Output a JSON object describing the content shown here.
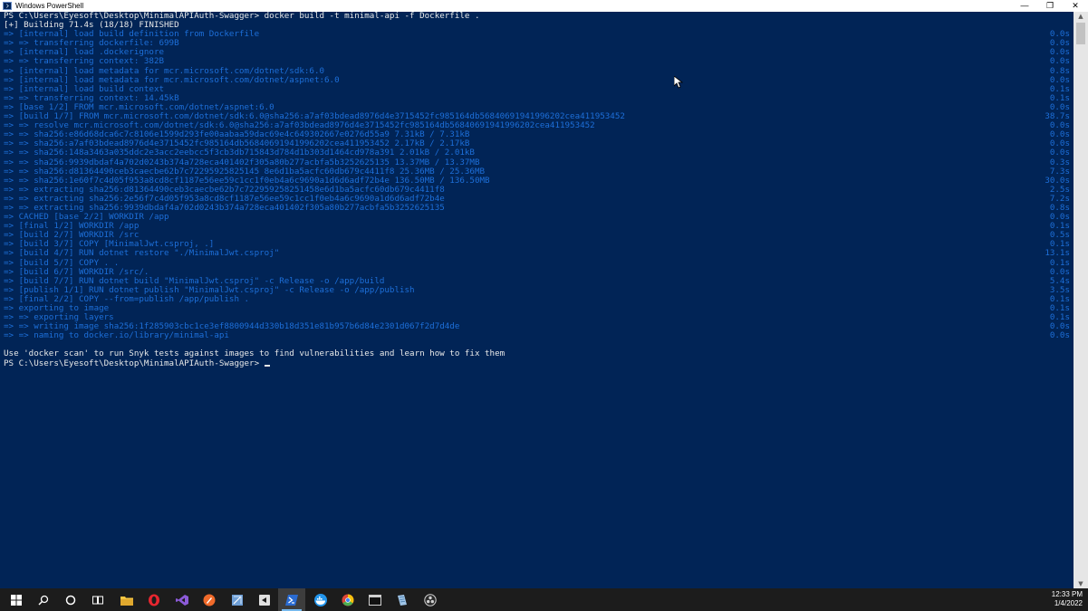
{
  "window": {
    "title": "Windows PowerShell",
    "controls": {
      "minimize": "—",
      "maximize": "❐",
      "close": "✕"
    }
  },
  "console": {
    "lines": [
      {
        "style": "white",
        "text": "PS C:\\Users\\Eyesoft\\Desktop\\MinimalAPIAuth-Swagger> docker build -t minimal-api -f Dockerfile .",
        "time": ""
      },
      {
        "style": "white",
        "text": "[+] Building 71.4s (18/18) FINISHED",
        "time": ""
      },
      {
        "style": "blue",
        "text": "=> [internal] load build definition from Dockerfile",
        "time": "0.0s"
      },
      {
        "style": "blue",
        "text": "=> => transferring dockerfile: 699B",
        "time": "0.0s"
      },
      {
        "style": "blue",
        "text": "=> [internal] load .dockerignore",
        "time": "0.0s"
      },
      {
        "style": "blue",
        "text": "=> => transferring context: 382B",
        "time": "0.0s"
      },
      {
        "style": "blue",
        "text": "=> [internal] load metadata for mcr.microsoft.com/dotnet/sdk:6.0",
        "time": "0.8s"
      },
      {
        "style": "blue",
        "text": "=> [internal] load metadata for mcr.microsoft.com/dotnet/aspnet:6.0",
        "time": "0.0s"
      },
      {
        "style": "blue",
        "text": "=> [internal] load build context",
        "time": "0.1s"
      },
      {
        "style": "blue",
        "text": "=> => transferring context: 14.45kB",
        "time": "0.1s"
      },
      {
        "style": "blue",
        "text": "=> [base 1/2] FROM mcr.microsoft.com/dotnet/aspnet:6.0",
        "time": "0.0s"
      },
      {
        "style": "blue",
        "text": "=> [build 1/7] FROM mcr.microsoft.com/dotnet/sdk:6.0@sha256:a7af03bdead8976d4e3715452fc985164db56840691941996202cea411953452",
        "time": "38.7s"
      },
      {
        "style": "blue",
        "text": "=> => resolve mcr.microsoft.com/dotnet/sdk:6.0@sha256:a7af03bdead8976d4e3715452fc985164db56840691941996202cea411953452",
        "time": "0.0s"
      },
      {
        "style": "blue",
        "text": "=> => sha256:e86d68dca6c7c8106e1599d293fe00aabaa59dac69e4c649302667e0276d55a9 7.31kB / 7.31kB",
        "time": "0.0s"
      },
      {
        "style": "blue",
        "text": "=> => sha256:a7af03bdead8976d4e3715452fc985164db56840691941996202cea411953452 2.17kB / 2.17kB",
        "time": "0.0s"
      },
      {
        "style": "blue",
        "text": "=> => sha256:148a3463a035ddc2e3acc2eebcc5f3cb3db715843d784d1b303d1464cd978a391 2.01kB / 2.01kB",
        "time": "0.0s"
      },
      {
        "style": "blue",
        "text": "=> => sha256:9939dbdaf4a702d0243b374a728eca401402f305a80b277acbfa5b3252625135 13.37MB / 13.37MB",
        "time": "0.3s"
      },
      {
        "style": "blue",
        "text": "=> => sha256:d81364490ceb3caecbe62b7c72295925825145 8e6d1ba5acfc60db679c4411f8 25.36MB / 25.36MB",
        "time": "7.3s"
      },
      {
        "style": "blue",
        "text": "=> => sha256:1e60f7c4d05f953a8cd8cf1187e56ee59c1cc1f0eb4a6c9690a1d6d6adf72b4e 136.50MB / 136.50MB",
        "time": "30.0s"
      },
      {
        "style": "blue",
        "text": "=> => extracting sha256:d81364490ceb3caecbe62b7c722959258251458e6d1ba5acfc60db679c4411f8",
        "time": "2.5s"
      },
      {
        "style": "blue",
        "text": "=> => extracting sha256:2e56f7c4d05f953a8cd8cf1187e56ee59c1cc1f0eb4a6c9690a1d6d6adf72b4e",
        "time": "7.2s"
      },
      {
        "style": "blue",
        "text": "=> => extracting sha256:9939dbdaf4a702d0243b374a728eca401402f305a80b277acbfa5b3252625135",
        "time": "0.8s"
      },
      {
        "style": "blue",
        "text": "=> CACHED [base 2/2] WORKDIR /app",
        "time": "0.0s"
      },
      {
        "style": "blue",
        "text": "=> [final 1/2] WORKDIR /app",
        "time": "0.1s"
      },
      {
        "style": "blue",
        "text": "=> [build 2/7] WORKDIR /src",
        "time": "0.5s"
      },
      {
        "style": "blue",
        "text": "=> [build 3/7] COPY [MinimalJwt.csproj, .]",
        "time": "0.1s"
      },
      {
        "style": "blue",
        "text": "=> [build 4/7] RUN dotnet restore \"./MinimalJwt.csproj\"",
        "time": "13.1s"
      },
      {
        "style": "blue",
        "text": "=> [build 5/7] COPY . .",
        "time": "0.1s"
      },
      {
        "style": "blue",
        "text": "=> [build 6/7] WORKDIR /src/.",
        "time": "0.0s"
      },
      {
        "style": "blue",
        "text": "=> [build 7/7] RUN dotnet build \"MinimalJwt.csproj\" -c Release -o /app/build",
        "time": "5.4s"
      },
      {
        "style": "blue",
        "text": "=> [publish 1/1] RUN dotnet publish \"MinimalJwt.csproj\" -c Release -o /app/publish",
        "time": "3.5s"
      },
      {
        "style": "blue",
        "text": "=> [final 2/2] COPY --from=publish /app/publish .",
        "time": "0.1s"
      },
      {
        "style": "blue",
        "text": "=> exporting to image",
        "time": "0.1s"
      },
      {
        "style": "blue",
        "text": "=> => exporting layers",
        "time": "0.1s"
      },
      {
        "style": "blue",
        "text": "=> => writing image sha256:1f285903cbc1ce3ef8800944d330b18d351e81b957b6d84e2301d067f2d7d4de",
        "time": "0.0s"
      },
      {
        "style": "blue",
        "text": "=> => naming to docker.io/library/minimal-api",
        "time": "0.0s"
      },
      {
        "style": "white",
        "text": "",
        "time": ""
      },
      {
        "style": "white",
        "text": "Use 'docker scan' to run Snyk tests against images to find vulnerabilities and learn how to fix them",
        "time": ""
      }
    ],
    "prompt": "PS C:\\Users\\Eyesoft\\Desktop\\MinimalAPIAuth-Swagger> "
  },
  "scrollbar": {
    "up": "▲",
    "down": "▼"
  },
  "taskbar": {
    "items": [
      {
        "name": "start-button",
        "icon": "windows-logo-icon",
        "color": "#ffffff",
        "active": false
      },
      {
        "name": "search-button",
        "icon": "search-icon",
        "color": "#ffffff",
        "active": false
      },
      {
        "name": "cortana-button",
        "icon": "cortana-circle-icon",
        "color": "#ffffff",
        "active": false
      },
      {
        "name": "task-view-button",
        "icon": "task-view-icon",
        "color": "#ffffff",
        "active": false
      },
      {
        "name": "file-explorer-app",
        "icon": "folder-icon",
        "color": "#f5c542",
        "active": false
      },
      {
        "name": "opera-app",
        "icon": "opera-icon",
        "color": "#e8262f",
        "active": false
      },
      {
        "name": "visual-studio-app",
        "icon": "visual-studio-icon",
        "color": "#8c5bd8",
        "active": false
      },
      {
        "name": "postman-app",
        "icon": "postman-icon",
        "color": "#f06a2a",
        "active": false
      },
      {
        "name": "remote-desktop-app",
        "icon": "remote-desktop-icon",
        "color": "#6f9fd6",
        "active": false
      },
      {
        "name": "sharex-app",
        "icon": "capture-icon",
        "color": "#e0e0e0",
        "active": false
      },
      {
        "name": "powershell-app",
        "icon": "powershell-icon",
        "color": "#2a6bd1",
        "active": true
      },
      {
        "name": "docker-app",
        "icon": "docker-whale-icon",
        "color": "#2396ed",
        "active": false
      },
      {
        "name": "chrome-app",
        "icon": "chrome-icon",
        "color": "#4caf50",
        "active": false
      },
      {
        "name": "terminal-app",
        "icon": "terminal-icon",
        "color": "#d0d0d0",
        "active": false
      },
      {
        "name": "notes-app",
        "icon": "notes-icon",
        "color": "#9fc5e8",
        "active": false
      },
      {
        "name": "obs-app",
        "icon": "obs-icon",
        "color": "#d0d0d0",
        "active": false
      }
    ],
    "clock": {
      "time": "12:33 PM",
      "date": "1/4/2022"
    }
  },
  "colors": {
    "console_bg": "#012456",
    "console_text": "#e8e8e8",
    "build_step_text": "#1d6fd9",
    "taskbar_bg": "#1c1c1c"
  }
}
